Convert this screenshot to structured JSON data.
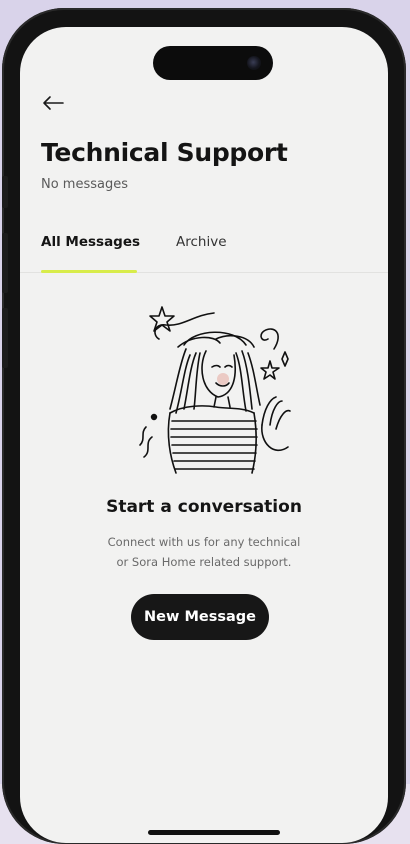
{
  "header": {
    "back_icon": "arrow-left-icon",
    "title": "Technical Support",
    "subtitle": "No messages"
  },
  "tabs": [
    {
      "label": "All Messages",
      "active": true
    },
    {
      "label": "Archive",
      "active": false
    }
  ],
  "empty_state": {
    "illustration": "woman-waving-illustration",
    "title": "Start a conversation",
    "text_line1": "Connect with us for any technical",
    "text_line2": "or Sora Home related support."
  },
  "actions": {
    "new_message_label": "New Message"
  },
  "colors": {
    "accent": "#d8ec4a",
    "button_bg": "#171717",
    "screen_bg": "#f2f2f1",
    "text_primary": "#141414"
  }
}
